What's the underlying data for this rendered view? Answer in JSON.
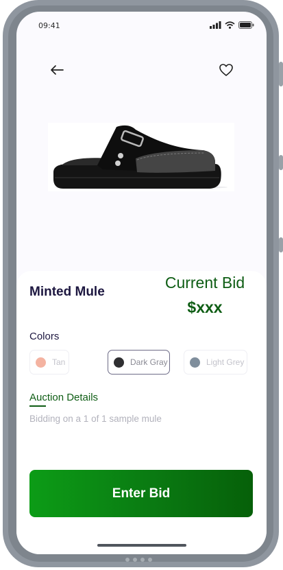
{
  "status_bar": {
    "time": "09:41"
  },
  "product": {
    "name": "Minted Mule"
  },
  "bid": {
    "title": "Current Bid",
    "price": "$xxx"
  },
  "colors": {
    "label": "Colors",
    "options": [
      {
        "name": "Tan",
        "swatch": "#f4b3a1"
      },
      {
        "name": "Dark Gray",
        "swatch": "#2f2f31"
      },
      {
        "name": "Light Grey",
        "swatch": "#7f8e9c"
      }
    ],
    "selected": "Dark Gray"
  },
  "auction": {
    "label": "Auction Details",
    "description": "Bidding on a 1 of 1 sample mule"
  },
  "actions": {
    "enter_bid": "Enter Bid"
  },
  "theme": {
    "accent": "#0e5d14",
    "button_green": "#0a8a12",
    "heading": "#1d1740"
  }
}
